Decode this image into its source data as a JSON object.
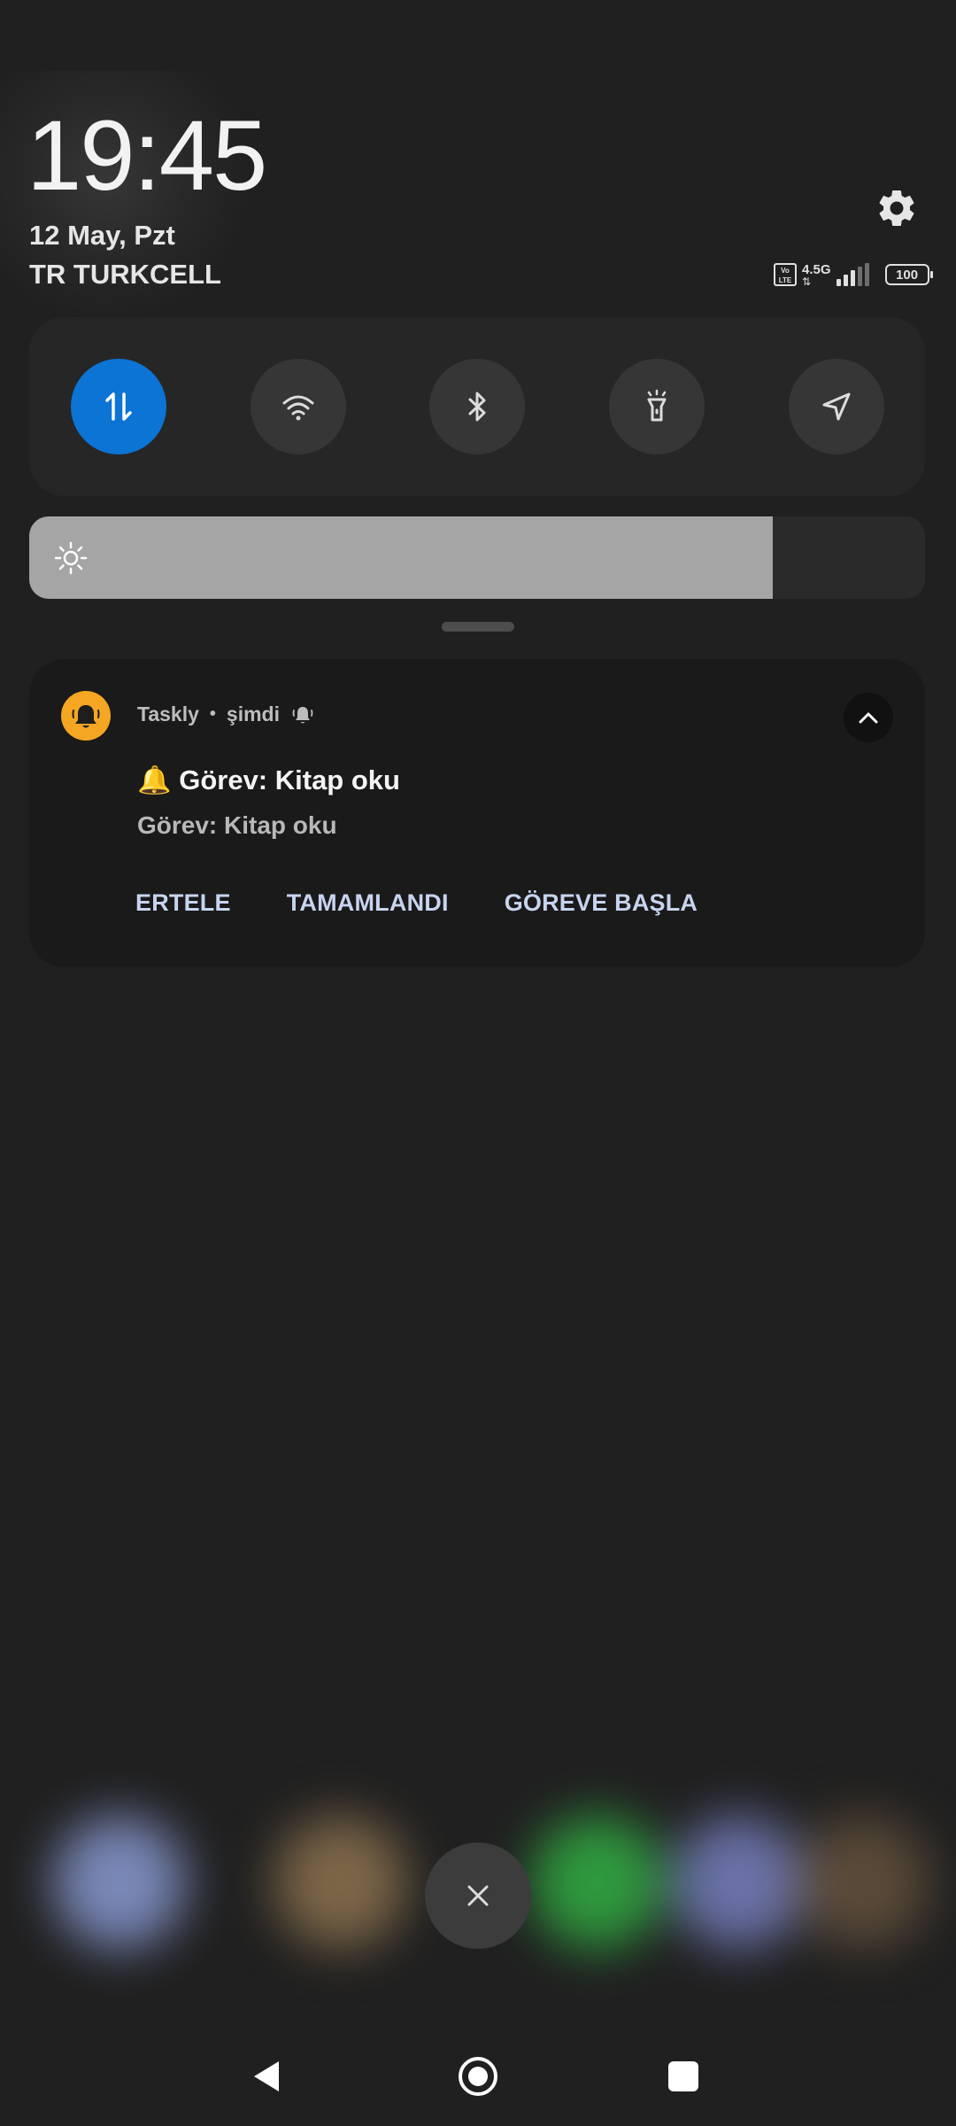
{
  "status": {
    "time": "19:45",
    "date": "12 May, Pzt",
    "carrier": "TR TURKCELL",
    "volte_label": "Vo LTE",
    "network_type": "4.5G",
    "battery_level": "100"
  },
  "quick_settings": {
    "tiles": [
      {
        "name": "mobile-data",
        "icon": "data-arrows-icon",
        "active": true
      },
      {
        "name": "wifi",
        "icon": "wifi-icon",
        "active": false
      },
      {
        "name": "bluetooth",
        "icon": "bluetooth-icon",
        "active": false
      },
      {
        "name": "flashlight",
        "icon": "flashlight-icon",
        "active": false
      },
      {
        "name": "location",
        "icon": "location-icon",
        "active": false
      }
    ],
    "brightness_level": 0.83
  },
  "notification": {
    "app_name": "Taskly",
    "separator": "•",
    "time_label": "şimdi",
    "title": "🔔 Görev: Kitap oku",
    "body": "Görev: Kitap oku",
    "actions": [
      "ERTELE",
      "TAMAMLANDI",
      "GÖREVE BAŞLA"
    ]
  },
  "colors": {
    "background": "#202020",
    "accent_active": "#0b74d4",
    "app_icon": "#f5a623",
    "action_text": "#c7d4ee"
  }
}
